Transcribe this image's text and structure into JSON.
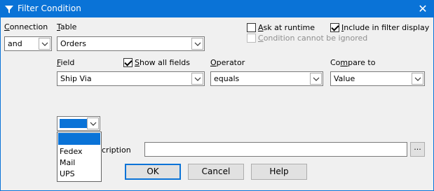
{
  "window": {
    "title": "Filter Condition",
    "close_glyph": "✕",
    "icon": "filter-icon",
    "accent": "#0a73d7"
  },
  "connection": {
    "label": "Connection",
    "value": "and"
  },
  "table": {
    "label": "Table",
    "value": "Orders"
  },
  "options": {
    "ask_at_runtime": {
      "label": "Ask at runtime",
      "checked": false
    },
    "include_in_filter_display": {
      "label": "Include in filter display",
      "checked": true
    },
    "condition_cannot_be_ignored": {
      "label": "Condition cannot be ignored",
      "checked": false,
      "disabled": true
    }
  },
  "field": {
    "label": "Field",
    "value": "Ship Via"
  },
  "show_all_fields": {
    "label": "Show all fields",
    "checked": true
  },
  "operator": {
    "label": "Operator",
    "value": "equals"
  },
  "compare_to": {
    "label": "Compare to",
    "value": "Value"
  },
  "value_combo": {
    "value": ""
  },
  "value_dropdown": {
    "items": [
      "",
      "Fedex",
      "Mail",
      "UPS"
    ],
    "selected_index": 0
  },
  "description": {
    "label_visible": "cription",
    "value": "",
    "browse_label": "..."
  },
  "buttons": {
    "ok": "OK",
    "cancel": "Cancel",
    "help": "Help"
  }
}
